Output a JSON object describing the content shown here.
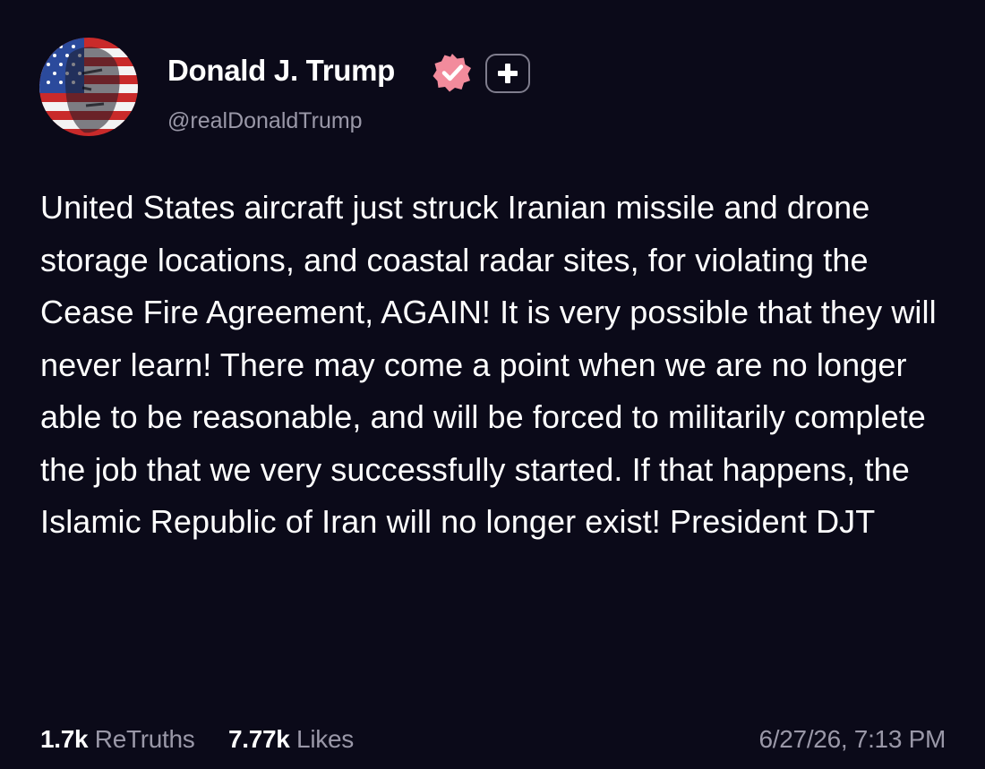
{
  "author": {
    "name": "Donald J. Trump",
    "handle": "@realDonaldTrump"
  },
  "post": {
    "text": "United States aircraft just struck Iranian missile and drone storage locations, and coastal radar sites, for violating the Cease Fire Agreement, AGAIN! It is very possible that they will never learn! There may come a point when we are no longer able to be reasonable, and will be forced to militarily complete the job that we very successfully started. If that happens, the Islamic Republic of Iran will no longer exist! President DJT"
  },
  "stats": {
    "retruths_count": "1.7k",
    "retruths_label": "ReTruths",
    "likes_count": "7.77k",
    "likes_label": "Likes"
  },
  "timestamp": "6/27/26, 7:13 PM",
  "colors": {
    "background": "#0b0a19",
    "text": "#ffffff",
    "muted_text": "#9a98a8",
    "verified_badge": "#f28b9c",
    "plus_badge_border": "#7f7d8d"
  },
  "icons": {
    "avatar": "american-flag-portrait-avatar",
    "verified": "verified-checkmark-icon",
    "plus": "plus-icon"
  }
}
